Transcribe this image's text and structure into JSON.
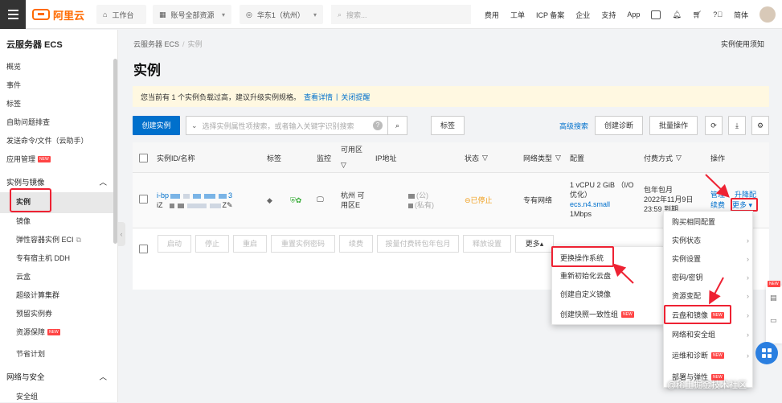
{
  "topbar": {
    "logo": "阿里云",
    "workbench": "工作台",
    "account": "账号全部资源",
    "region": "华东1（杭州）",
    "search_placeholder": "搜索...",
    "links": [
      "费用",
      "工单",
      "ICP 备案",
      "企业",
      "支持",
      "App"
    ],
    "lang": "简体"
  },
  "sidebar": {
    "title": "云服务器 ECS",
    "items": [
      "概览",
      "事件",
      "标签",
      "自助问题排查",
      "发送命令/文件（云助手）",
      "应用管理"
    ],
    "new_badge": "NEW",
    "group1": "实例与镜像",
    "group1_items": [
      "实例",
      "镜像",
      "弹性容器实例 ECI",
      "专有宿主机 DDH",
      "云盒",
      "超级计算集群",
      "预留实例券",
      "资源保障",
      "节省计划"
    ],
    "group2": "网络与安全",
    "group2_items": [
      "安全组"
    ]
  },
  "main": {
    "breadcrumb": [
      "云服务器 ECS",
      "实例"
    ],
    "notice_link": "实例使用须知",
    "title": "实例",
    "alert_text": "您当前有 1 个实例负载过高，建议升级实例规格。",
    "alert_link1": "查看详情",
    "alert_sep": "|",
    "alert_link2": "关闭提醒",
    "toolbar": {
      "create": "创建实例",
      "search_placeholder": "选择实例属性项搜索，或者输入关键字识别搜索",
      "tag": "标签",
      "advanced": "高级搜索",
      "diagnose": "创建诊断",
      "bulk": "批量操作"
    },
    "columns": [
      "实例ID/名称",
      "标签",
      "监控",
      "可用区",
      "IP地址",
      "状态",
      "网络类型",
      "配置",
      "付费方式",
      "操作"
    ],
    "row": {
      "id_prefix": "i-bp",
      "id_suffix": "3",
      "name_prefix": "iZ",
      "name_suffix": "Z",
      "zone": "杭州 可用区E",
      "ip_public": "(公)",
      "ip_private": "(私有)",
      "status": "已停止",
      "network": "专有网络",
      "config_line1": "1 vCPU 2 GiB （I/O优化）",
      "config_type": "ecs.n4.small",
      "config_bw": "1Mbps",
      "pay_line1": "包年包月",
      "pay_line2": "2022年11月9日",
      "pay_line3": "23:59 到期",
      "op_manage": "管理",
      "op_upgrade": "升降配",
      "op_renew": "续费",
      "op_more": "更多"
    },
    "bulk_buttons": [
      "启动",
      "停止",
      "重启",
      "重置实例密码",
      "续费",
      "按量付费转包年包月",
      "释放设置"
    ],
    "bulk_more": "更多"
  },
  "left_menu": [
    "更换操作系统",
    "重新初始化云盘",
    "创建自定义镜像",
    "创建快照一致性组"
  ],
  "left_menu_new": "NEW",
  "right_menu": [
    "购买相同配置",
    "实例状态",
    "实例设置",
    "密码/密钥",
    "资源变配",
    "云盘和镜像",
    "网络和安全组",
    "运维和诊断",
    "部署与弹性"
  ],
  "right_menu_new": "NEW",
  "float_new": "NEW",
  "watermark": "@稀土掘金技术社区",
  "colors": {
    "accent": "#0070cc",
    "brand": "#ff6a00",
    "highlight": "#e23"
  }
}
